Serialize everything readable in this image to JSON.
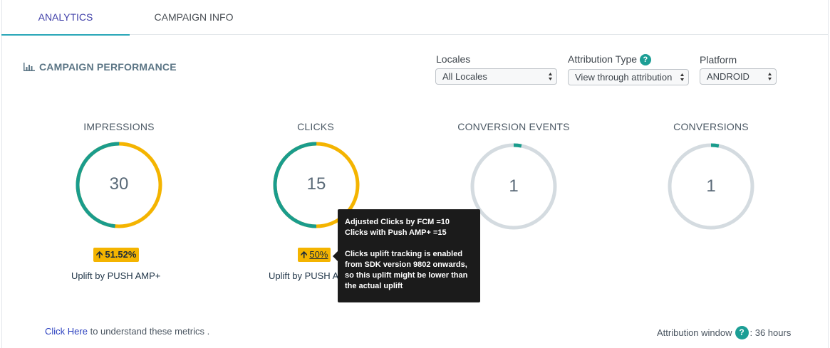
{
  "tabs": [
    {
      "label": "ANALYTICS"
    },
    {
      "label": "CAMPAIGN INFO"
    }
  ],
  "section_title": "CAMPAIGN PERFORMANCE",
  "filters": {
    "locales": {
      "label": "Locales",
      "value": "All Locales"
    },
    "attribution_type": {
      "label": "Attribution Type",
      "help": "?",
      "value": "View through attribution"
    },
    "platform": {
      "label": "Platform",
      "value": "ANDROID"
    }
  },
  "metrics": [
    {
      "title": "IMPRESSIONS",
      "value": "30",
      "uplift": "51.52%",
      "uplift_label": "Uplift by PUSH AMP+",
      "primary_fraction": 0.485
    },
    {
      "title": "CLICKS",
      "value": "15",
      "uplift": "50%",
      "uplift_label": "Uplift by PUSH AMP+",
      "primary_fraction": 0.5
    },
    {
      "title": "CONVERSION EVENTS",
      "value": "1",
      "primary_fraction": 0.03
    },
    {
      "title": "CONVERSIONS",
      "value": "1",
      "primary_fraction": 0.03
    }
  ],
  "tooltip": {
    "line1": "Adjusted Clicks by FCM =10",
    "line2": "Clicks with Push AMP+ =15",
    "line3": "Clicks uplift tracking is enabled",
    "line4": "from SDK version 9802 onwards,",
    "line5": "so this uplift might be lower than",
    "line6": "the actual uplift"
  },
  "footer": {
    "link_text": "Click Here",
    "link_suffix": " to understand these metrics .",
    "attribution_label": "Attribution window",
    "attribution_help": "?",
    "attribution_value": ": 36 hours"
  },
  "colors": {
    "teal": "#1a9c8c",
    "yellow": "#f4b400",
    "track": "#d4dbe0",
    "help": "#1c9e95",
    "link": "#2a3fbf"
  },
  "icons": {
    "chart": "bar-chart-icon",
    "select_arrows": "select-arrows-icon",
    "uplift_arrow": "arrow-up-icon"
  }
}
